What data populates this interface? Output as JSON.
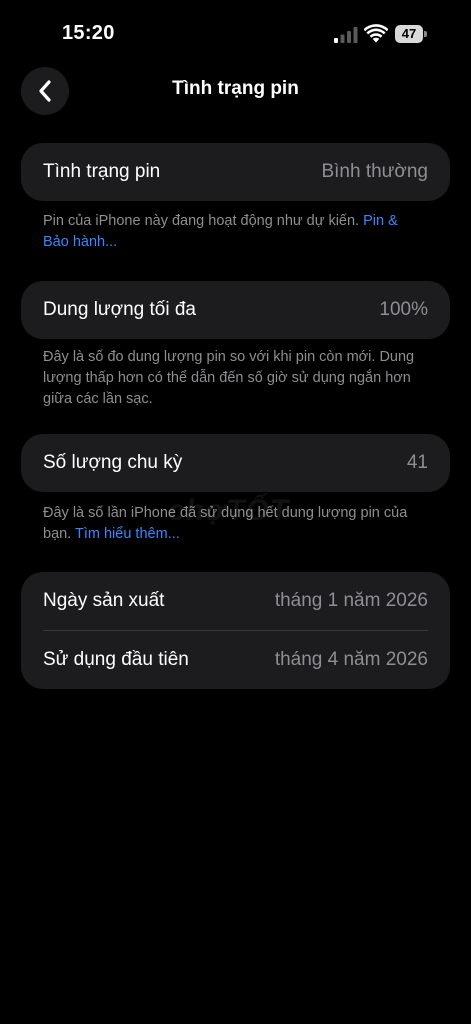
{
  "status_bar": {
    "time": "15:20",
    "battery_level": "47",
    "icons": [
      "signal-icon",
      "wifi-icon",
      "battery-icon"
    ]
  },
  "nav": {
    "back_icon": "chevron-left-icon",
    "title": "Tình trạng pin"
  },
  "health": {
    "label": "Tình trạng pin",
    "value": "Bình thường",
    "footnote_text": "Pin của iPhone này đang hoạt động như dự kiến. ",
    "footnote_link": "Pin & Bảo hành..."
  },
  "capacity": {
    "label": "Dung lượng tối đa",
    "value": "100%",
    "footnote_text": "Đây là số đo dung lượng pin so với khi pin còn mới. Dung lượng thấp hơn có thể dẫn đến số giờ sử dụng ngắn hơn giữa các lần sạc."
  },
  "cycles": {
    "label": "Số lượng chu kỳ",
    "value": "41",
    "footnote_text": "Đây là số lần iPhone đã sử dụng hết dung lượng pin của bạn. ",
    "footnote_link": "Tìm hiểu thêm..."
  },
  "dates": {
    "manufacture_label": "Ngày sản xuất",
    "manufacture_value": "tháng 1 năm 2026",
    "first_use_label": "Sử dụng đầu tiên",
    "first_use_value": "tháng 4 năm 2026"
  },
  "watermark": "chợTỐT",
  "colors": {
    "background": "#000000",
    "card": "#1c1c1e",
    "secondary_text": "#8e8e93",
    "link": "#3a86ff"
  }
}
